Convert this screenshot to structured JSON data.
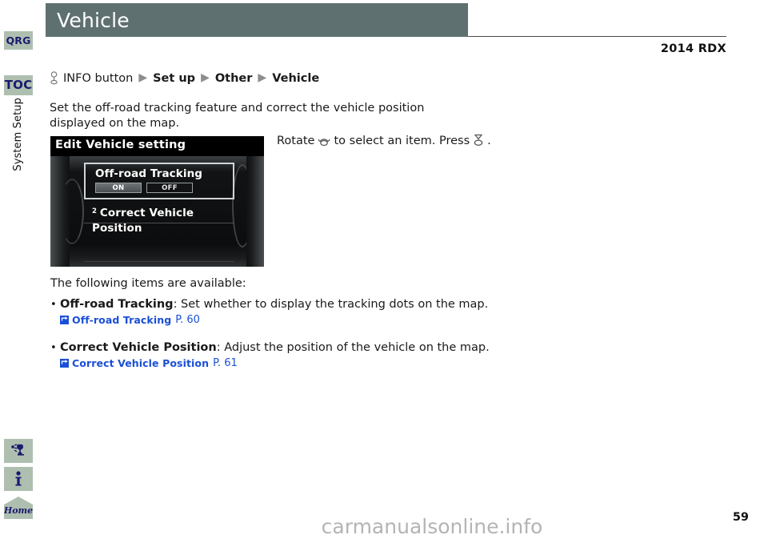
{
  "document": {
    "page_title": "Vehicle",
    "model_name": "2014 RDX",
    "page_number": "59",
    "watermark": "carmanualsonline.info"
  },
  "sidebar": {
    "tabs": [
      {
        "label": "QRG",
        "name": "qrg"
      },
      {
        "label": "TOC",
        "name": "toc"
      }
    ],
    "section_label": "System Setup",
    "icons": [
      {
        "name": "voice-command-icon",
        "glyph": "voice"
      },
      {
        "name": "info-icon",
        "glyph": "info"
      },
      {
        "name": "home-icon",
        "glyph": "Home"
      }
    ]
  },
  "breadcrumb": {
    "knob_icon": "rotary-knob-icon",
    "first": "INFO button",
    "separator": "▶",
    "crumbs": [
      "Set up",
      "Other",
      "Vehicle"
    ]
  },
  "intro": {
    "text": "Set the off-road tracking feature and correct the vehicle position displayed on the map."
  },
  "nav_screen": {
    "title": "Edit Vehicle setting",
    "rows": [
      {
        "label": "Off-road Tracking",
        "selected": true,
        "toggles": [
          {
            "label": "ON",
            "state": "selected"
          },
          {
            "label": "OFF",
            "state": "unselected"
          }
        ]
      },
      {
        "index": "2",
        "label": "Correct Vehicle Position",
        "selected": false
      }
    ]
  },
  "rotate_note": {
    "prefix": "Rotate",
    "rotate_icon": "rotary-knob-icon",
    "middle": "to select an item. Press",
    "press_icon": "press-knob-icon",
    "suffix": "."
  },
  "items": {
    "lead": "The following items are available:",
    "list": [
      {
        "bullet": "•",
        "term": "Off-road Tracking",
        "description": ": Set whether to display the tracking dots on the map.",
        "xref_label": "Off-road Tracking",
        "xref_page": "P. 60"
      },
      {
        "bullet": "•",
        "term": "Correct Vehicle Position",
        "description": ": Adjust the position of the vehicle on the map.",
        "xref_label": "Correct Vehicle Position",
        "xref_page": "P. 61"
      }
    ]
  },
  "colors": {
    "header_bar": "#5f7071",
    "sidebar_tab": "#aebfb0",
    "tab_text": "#1a1a6e",
    "xref_blue": "#1a4fd6",
    "watermark_gray": "#b4b4b4"
  }
}
